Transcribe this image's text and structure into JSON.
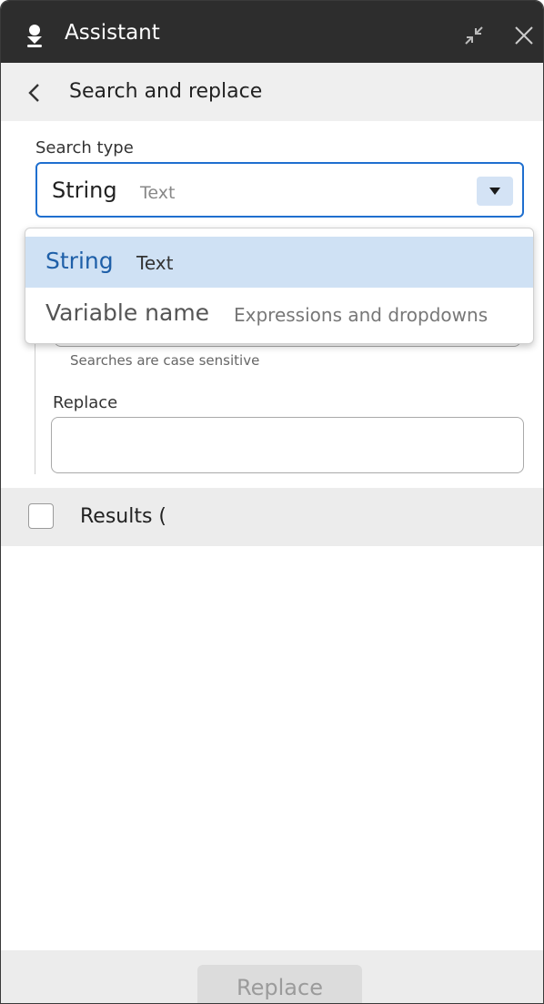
{
  "window": {
    "title": "Assistant"
  },
  "header": {
    "heading": "Search and replace"
  },
  "search_type": {
    "label": "Search type",
    "selected_value": "String",
    "selected_sub": "Text",
    "options": [
      {
        "label": "String",
        "sub": "Text"
      },
      {
        "label": "Variable name",
        "sub": "Expressions and dropdowns"
      }
    ]
  },
  "search": {
    "hint": "Searches are case sensitive"
  },
  "replace": {
    "label": "Replace",
    "value": ""
  },
  "results": {
    "label": "Results ("
  },
  "footer": {
    "replace_button": "Replace"
  },
  "colors": {
    "titlebar": "#2d2d2d",
    "accent": "#1f6fcf",
    "selected_option_bg": "#cfe1f4"
  }
}
